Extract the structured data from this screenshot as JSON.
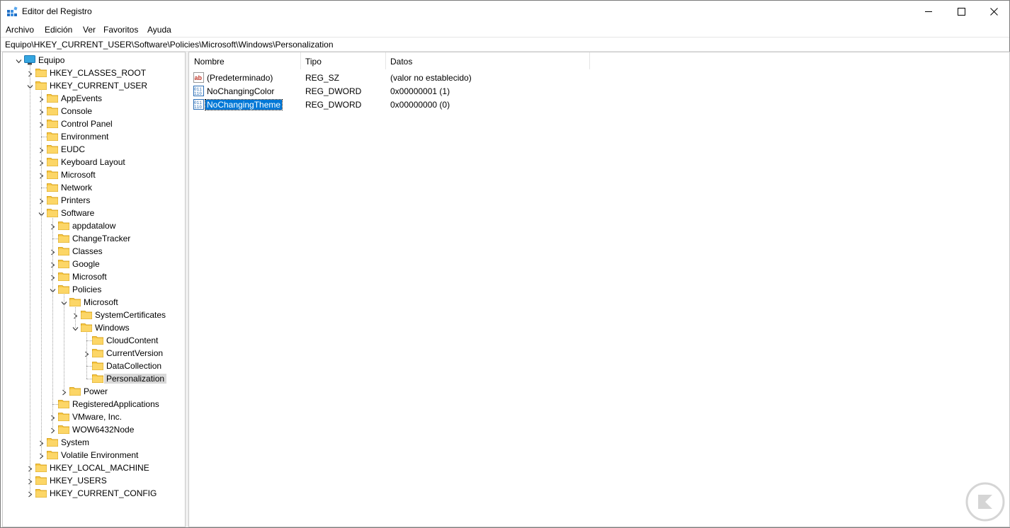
{
  "window": {
    "title": "Editor del Registro"
  },
  "menu": [
    "Archivo",
    "Edición",
    "Ver",
    "Favoritos",
    "Ayuda"
  ],
  "address": "Equipo\\HKEY_CURRENT_USER\\Software\\Policies\\Microsoft\\Windows\\Personalization",
  "tree": [
    {
      "label": "Equipo",
      "depth": 0,
      "state": "expanded",
      "icon": "computer"
    },
    {
      "label": "HKEY_CLASSES_ROOT",
      "depth": 1,
      "state": "collapsed"
    },
    {
      "label": "HKEY_CURRENT_USER",
      "depth": 1,
      "state": "expanded"
    },
    {
      "label": "AppEvents",
      "depth": 2,
      "state": "collapsed"
    },
    {
      "label": "Console",
      "depth": 2,
      "state": "collapsed"
    },
    {
      "label": "Control Panel",
      "depth": 2,
      "state": "collapsed"
    },
    {
      "label": "Environment",
      "depth": 2,
      "state": "leaf"
    },
    {
      "label": "EUDC",
      "depth": 2,
      "state": "collapsed"
    },
    {
      "label": "Keyboard Layout",
      "depth": 2,
      "state": "collapsed"
    },
    {
      "label": "Microsoft",
      "depth": 2,
      "state": "collapsed"
    },
    {
      "label": "Network",
      "depth": 2,
      "state": "leaf"
    },
    {
      "label": "Printers",
      "depth": 2,
      "state": "collapsed"
    },
    {
      "label": "Software",
      "depth": 2,
      "state": "expanded"
    },
    {
      "label": "appdatalow",
      "depth": 3,
      "state": "collapsed"
    },
    {
      "label": "ChangeTracker",
      "depth": 3,
      "state": "leaf"
    },
    {
      "label": "Classes",
      "depth": 3,
      "state": "collapsed"
    },
    {
      "label": "Google",
      "depth": 3,
      "state": "collapsed"
    },
    {
      "label": "Microsoft",
      "depth": 3,
      "state": "collapsed"
    },
    {
      "label": "Policies",
      "depth": 3,
      "state": "expanded"
    },
    {
      "label": "Microsoft",
      "depth": 4,
      "state": "expanded"
    },
    {
      "label": "SystemCertificates",
      "depth": 5,
      "state": "collapsed"
    },
    {
      "label": "Windows",
      "depth": 5,
      "state": "expanded"
    },
    {
      "label": "CloudContent",
      "depth": 6,
      "state": "leaf"
    },
    {
      "label": "CurrentVersion",
      "depth": 6,
      "state": "collapsed"
    },
    {
      "label": "DataCollection",
      "depth": 6,
      "state": "leaf"
    },
    {
      "label": "Personalization",
      "depth": 6,
      "state": "leaf",
      "selected": true
    },
    {
      "label": "Power",
      "depth": 4,
      "state": "collapsed"
    },
    {
      "label": "RegisteredApplications",
      "depth": 3,
      "state": "leaf"
    },
    {
      "label": "VMware, Inc.",
      "depth": 3,
      "state": "collapsed"
    },
    {
      "label": "WOW6432Node",
      "depth": 3,
      "state": "collapsed"
    },
    {
      "label": "System",
      "depth": 2,
      "state": "collapsed"
    },
    {
      "label": "Volatile Environment",
      "depth": 2,
      "state": "collapsed"
    },
    {
      "label": "HKEY_LOCAL_MACHINE",
      "depth": 1,
      "state": "collapsed"
    },
    {
      "label": "HKEY_USERS",
      "depth": 1,
      "state": "collapsed"
    },
    {
      "label": "HKEY_CURRENT_CONFIG",
      "depth": 1,
      "state": "collapsed"
    }
  ],
  "columns": [
    "Nombre",
    "Tipo",
    "Datos"
  ],
  "values": [
    {
      "name": "(Predeterminado)",
      "type": "REG_SZ",
      "data": "(valor no establecido)",
      "icon": "string-value-icon"
    },
    {
      "name": "NoChangingColor",
      "type": "REG_DWORD",
      "data": "0x00000001 (1)",
      "icon": "binary-value-icon"
    },
    {
      "name": "NoChangingTheme",
      "type": "REG_DWORD",
      "data": "0x00000000 (0)",
      "icon": "binary-value-icon",
      "selected": true
    }
  ],
  "colors": {
    "selection": "#0078d7",
    "tree_selection": "#d9d9d9",
    "folder": "#f8c846"
  }
}
